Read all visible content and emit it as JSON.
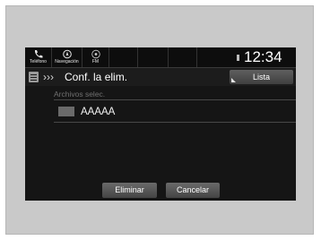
{
  "statusbar": {
    "phone_label": "Teléfono",
    "nav_label": "Navegación",
    "fm_label": "FM",
    "clock": "12:34"
  },
  "titlebar": {
    "title": "Conf. la elim.",
    "list_button": "Lista"
  },
  "list": {
    "header": "Archivos selec.",
    "items": [
      {
        "label": "AAAAA"
      }
    ]
  },
  "actions": {
    "delete_label": "Eliminar",
    "cancel_label": "Cancelar"
  },
  "icons": {
    "phone": "phone-icon",
    "navigation": "navigation-icon",
    "radio": "radio-icon",
    "document": "document-icon"
  }
}
